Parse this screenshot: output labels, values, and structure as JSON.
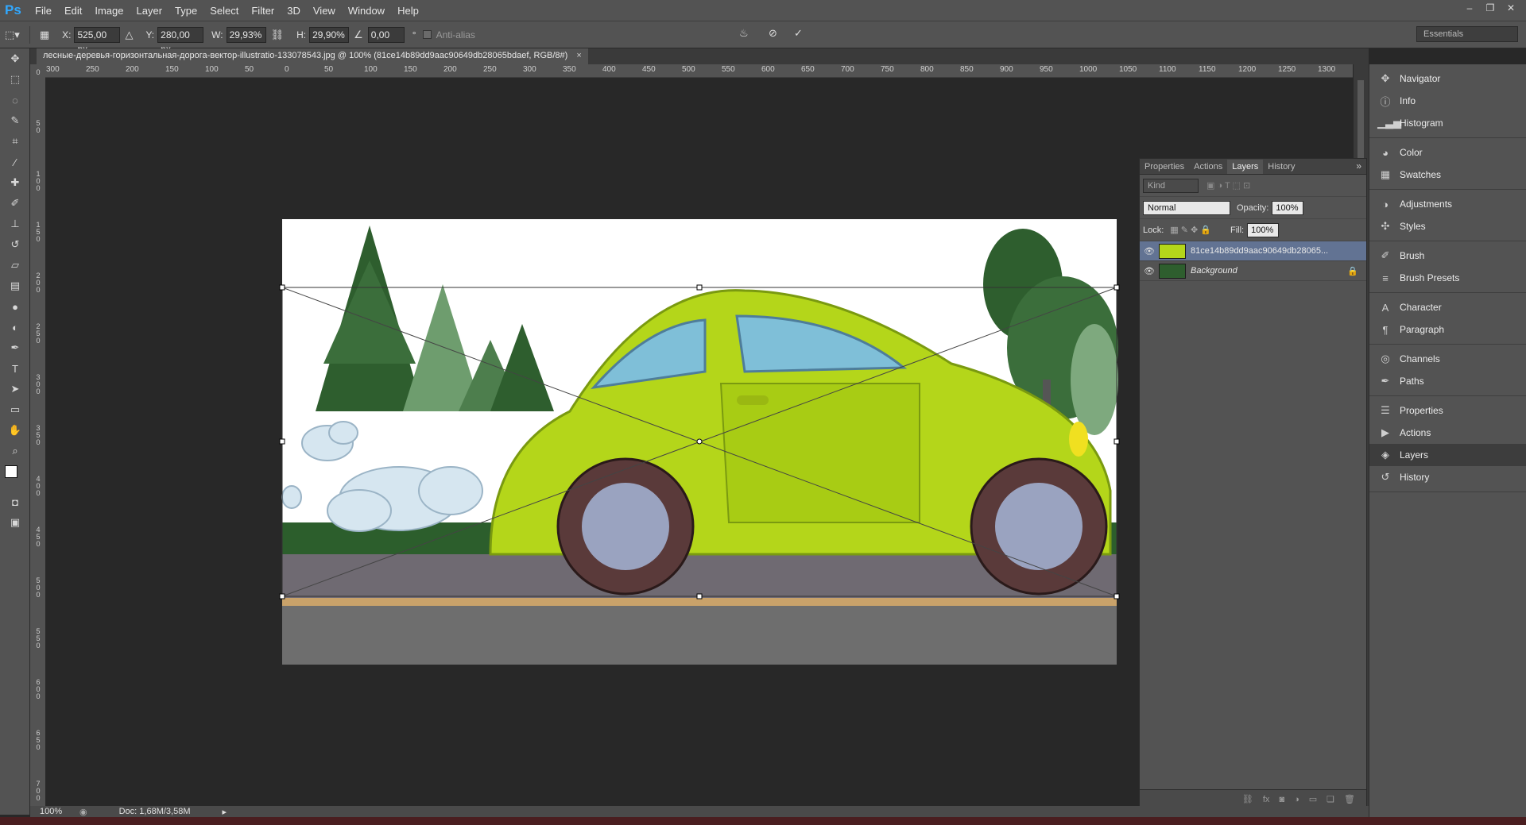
{
  "app": {
    "logo": "Ps"
  },
  "menu": [
    "File",
    "Edit",
    "Image",
    "Layer",
    "Type",
    "Select",
    "Filter",
    "3D",
    "View",
    "Window",
    "Help"
  ],
  "options_bar": {
    "x_label": "X:",
    "x_value": "525,00 px",
    "y_label": "Y:",
    "y_value": "280,00 px",
    "w_label": "W:",
    "w_value": "29,93%",
    "h_label": "H:",
    "h_value": "29,90%",
    "angle_value": "0,00",
    "angle_unit": "°",
    "anti_alias_label": "Anti-alias",
    "workspace": "Essentials"
  },
  "document": {
    "tab_title": "лесные-деревья-горизонтальная-дорога-вектор-illustratio-133078543.jpg @ 100% (81ce14b89dd9aac90649db28065bdaef, RGB/8#)",
    "close": "×"
  },
  "ruler_h": [
    "300",
    "250",
    "200",
    "150",
    "100",
    "50",
    "0",
    "50",
    "100",
    "150",
    "200",
    "250",
    "300",
    "350",
    "400",
    "450",
    "500",
    "550",
    "600",
    "650",
    "700",
    "750",
    "800",
    "850",
    "900",
    "950",
    "1000",
    "1050",
    "1100",
    "1150",
    "1200",
    "1250",
    "1300"
  ],
  "ruler_v": [
    "0",
    "50",
    "100",
    "150",
    "200",
    "250",
    "300",
    "350",
    "400",
    "450",
    "500",
    "550",
    "600",
    "650",
    "700"
  ],
  "status": {
    "zoom": "100%",
    "doc": "Doc: 1,68M/3,58M"
  },
  "layers_panel": {
    "tabs": [
      "Properties",
      "Actions",
      "Layers",
      "History"
    ],
    "active_tab": "Layers",
    "kind_label": "Kind",
    "blend_mode": "Normal",
    "opacity_label": "Opacity:",
    "opacity_value": "100%",
    "lock_label": "Lock:",
    "fill_label": "Fill:",
    "fill_value": "100%",
    "layers": [
      {
        "name": "81ce14b89dd9aac90649db28065...",
        "selected": true
      },
      {
        "name": "Background",
        "selected": false
      }
    ]
  },
  "dock": [
    {
      "group": [
        "Navigator",
        "Info",
        "Histogram"
      ]
    },
    {
      "group": [
        "Color",
        "Swatches"
      ]
    },
    {
      "group": [
        "Adjustments",
        "Styles"
      ]
    },
    {
      "group": [
        "Brush",
        "Brush Presets"
      ]
    },
    {
      "group": [
        "Character",
        "Paragraph"
      ]
    },
    {
      "group": [
        "Channels",
        "Paths"
      ]
    },
    {
      "group": [
        "Properties",
        "Actions",
        "Layers",
        "History"
      ]
    }
  ],
  "dock_active": "Layers",
  "colors": {
    "ui_bg": "#535353",
    "canvas_bg": "#282828",
    "selected_layer": "#627393",
    "accent": "#31a8ff"
  }
}
